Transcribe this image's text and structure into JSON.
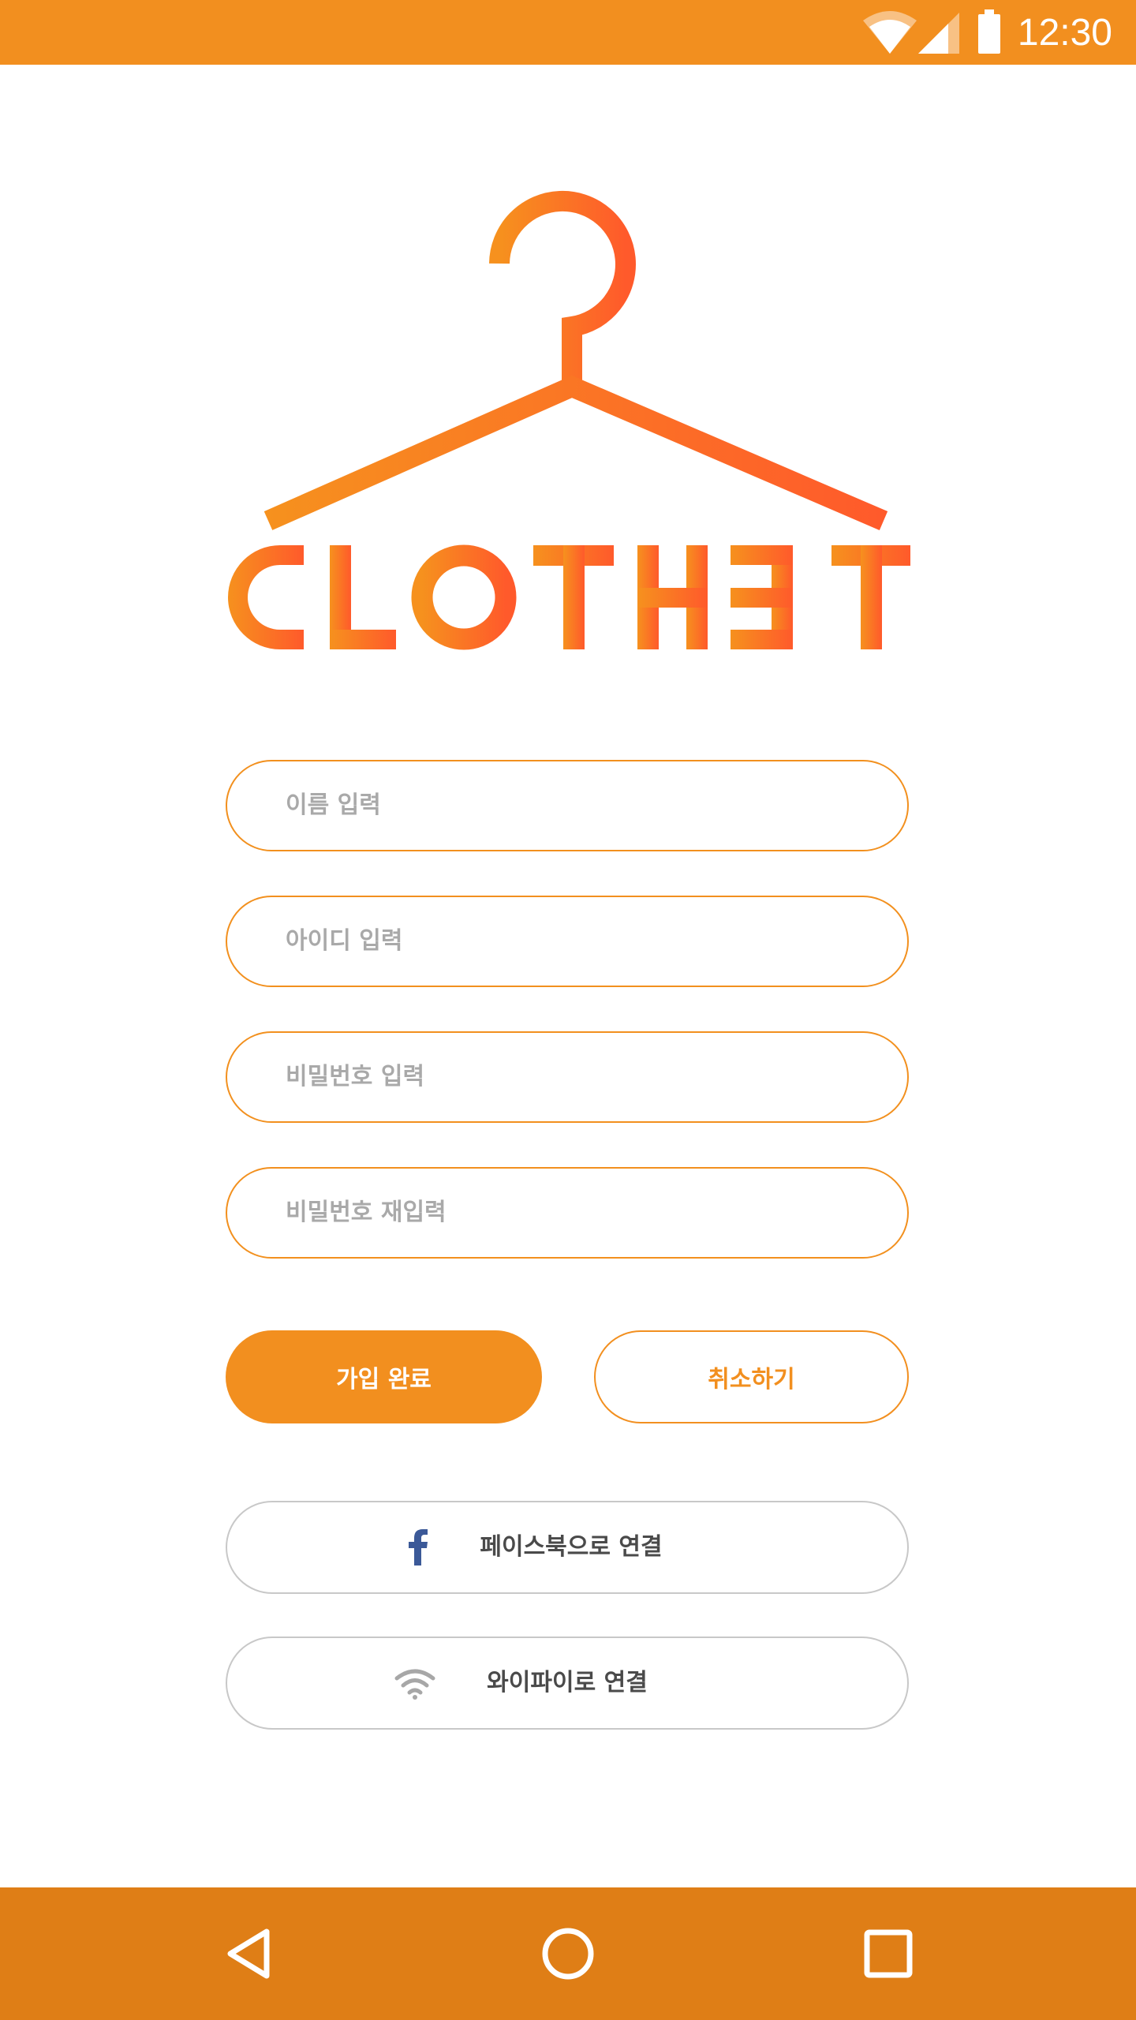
{
  "status_bar": {
    "time": "12:30",
    "icons": [
      "wifi-icon",
      "signal-icon",
      "battery-icon"
    ]
  },
  "logo": {
    "text": "CLOTHET",
    "icon": "hanger-icon",
    "colors": [
      "#F6911E",
      "#FF5A2B"
    ]
  },
  "form": {
    "name_placeholder": "이름 입력",
    "id_placeholder": "아이디 입력",
    "password_placeholder": "비밀번호 입력",
    "password_confirm_placeholder": "비밀번호 재입력"
  },
  "actions": {
    "signup_label": "가입 완료",
    "cancel_label": "취소하기"
  },
  "social": {
    "facebook_label": "페이스북으로 연결",
    "facebook_icon": "facebook-icon",
    "wifi_label": "와이파이로 연결",
    "wifi_icon": "wifi-icon"
  },
  "nav": {
    "icons": [
      "back-icon",
      "home-icon",
      "recents-icon"
    ]
  },
  "colors": {
    "accent": "#F28F1F",
    "nav_background": "#DF7E16",
    "placeholder_text": "#A9A9A9",
    "facebook_blue": "#3B5998"
  }
}
